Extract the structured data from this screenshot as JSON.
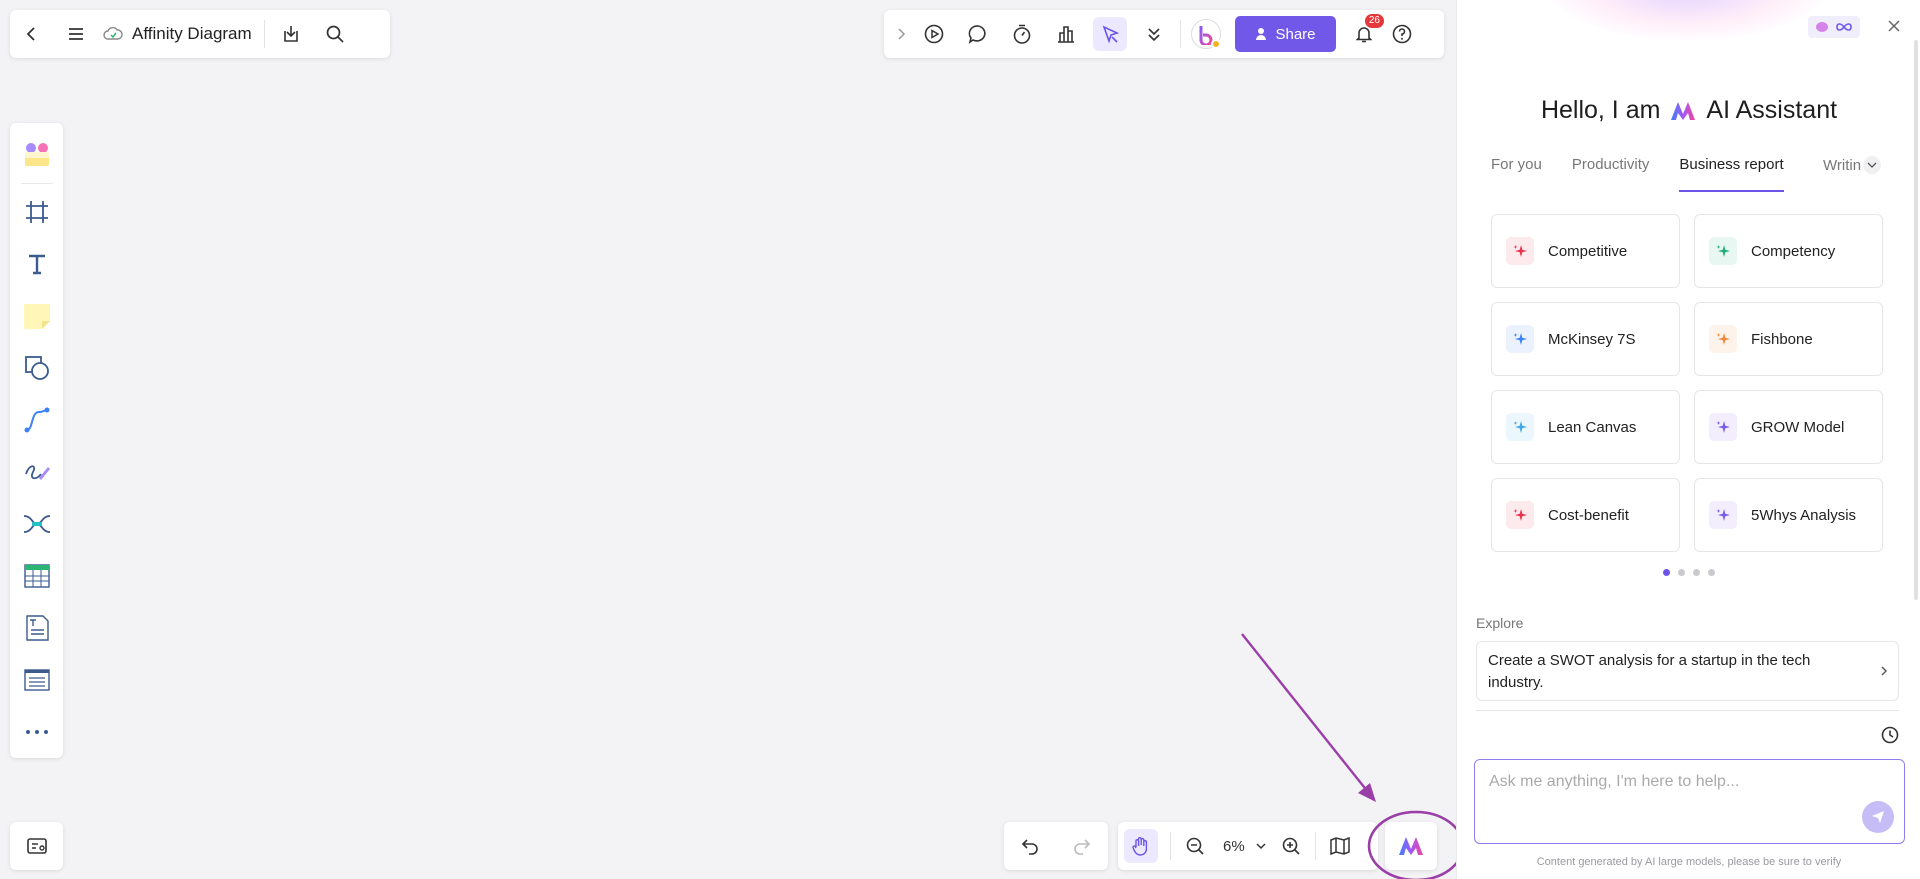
{
  "doc": {
    "title": "Affinity Diagram"
  },
  "toolbar": {
    "share_label": "Share",
    "notification_count": "26"
  },
  "zoom": {
    "value": "6%"
  },
  "ai": {
    "greeting_prefix": "Hello, I am",
    "assistant_name": "AI Assistant",
    "tabs": [
      {
        "label": "For you"
      },
      {
        "label": "Productivity"
      },
      {
        "label": "Business report"
      },
      {
        "label": "Writin"
      }
    ],
    "active_tab": "Business report",
    "cards": [
      {
        "label": "Competitive",
        "color": "#e8344c"
      },
      {
        "label": "Competency",
        "color": "#22b07a"
      },
      {
        "label": "McKinsey 7S",
        "color": "#3b82f6"
      },
      {
        "label": "Fishbone",
        "color": "#f2863a"
      },
      {
        "label": "Lean Canvas",
        "color": "#3ea8e8"
      },
      {
        "label": "GROW Model",
        "color": "#7b5ce8"
      },
      {
        "label": "Cost-benefit",
        "color": "#e8344c"
      },
      {
        "label": "5Whys Analysis",
        "color": "#7b5ce8"
      }
    ],
    "page_count": 4,
    "current_page": 1,
    "explore_label": "Explore",
    "explore_prompt": "Create a SWOT analysis for a startup in the tech industry.",
    "input_placeholder": "Ask me anything, I'm here to help...",
    "disclaimer": "Content generated by AI large models, please be sure to verify"
  },
  "colors": {
    "accent": "#7158e9",
    "annotation": "#9b3fa8"
  }
}
